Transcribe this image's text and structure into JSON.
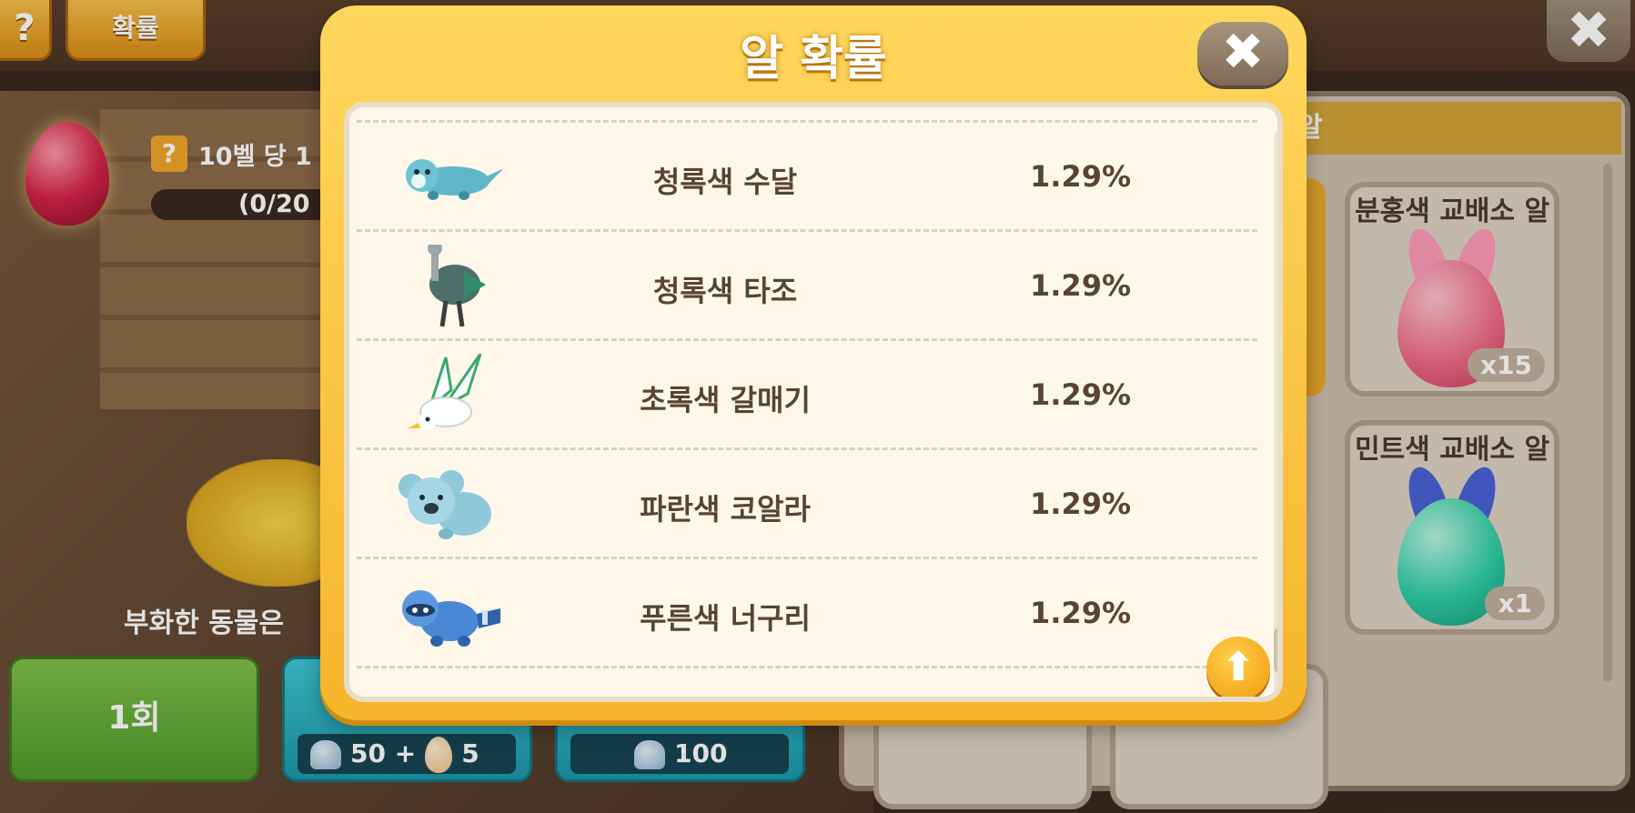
{
  "topbar": {
    "help_label": "?",
    "probability_label": "확률",
    "close_label": "✖"
  },
  "left": {
    "level_badge": "?",
    "level_text": "10벨 당 1",
    "progress_text": "(0/20",
    "hatched_text": "부화한 동물은",
    "once_button": "1회",
    "multi_cost_bells": "50 +",
    "multi_cost_eggs": "5",
    "multi2_cost_bells": "100"
  },
  "shop": {
    "header": "알",
    "cards": [
      {
        "title": "분홍색 교배소 알",
        "count": "x15",
        "color": "#f06e8c",
        "ear": "#ff9bb8"
      },
      {
        "title": "민트색 교배소 알",
        "count": "x1",
        "color": "#2fcfa4",
        "ear": "#4b62d6"
      }
    ]
  },
  "modal": {
    "title": "알 확률",
    "close_label": "✖",
    "to_top_label": "⬆",
    "rows": [
      {
        "name": "청록색 수달",
        "pct": "1.29%",
        "icon": "otter-icon"
      },
      {
        "name": "청록색 타조",
        "pct": "1.29%",
        "icon": "ostrich-icon"
      },
      {
        "name": "초록색 갈매기",
        "pct": "1.29%",
        "icon": "seagull-icon"
      },
      {
        "name": "파란색 코알라",
        "pct": "1.29%",
        "icon": "koala-icon"
      },
      {
        "name": "푸른색 너구리",
        "pct": "1.29%",
        "icon": "raccoon-icon"
      }
    ]
  }
}
